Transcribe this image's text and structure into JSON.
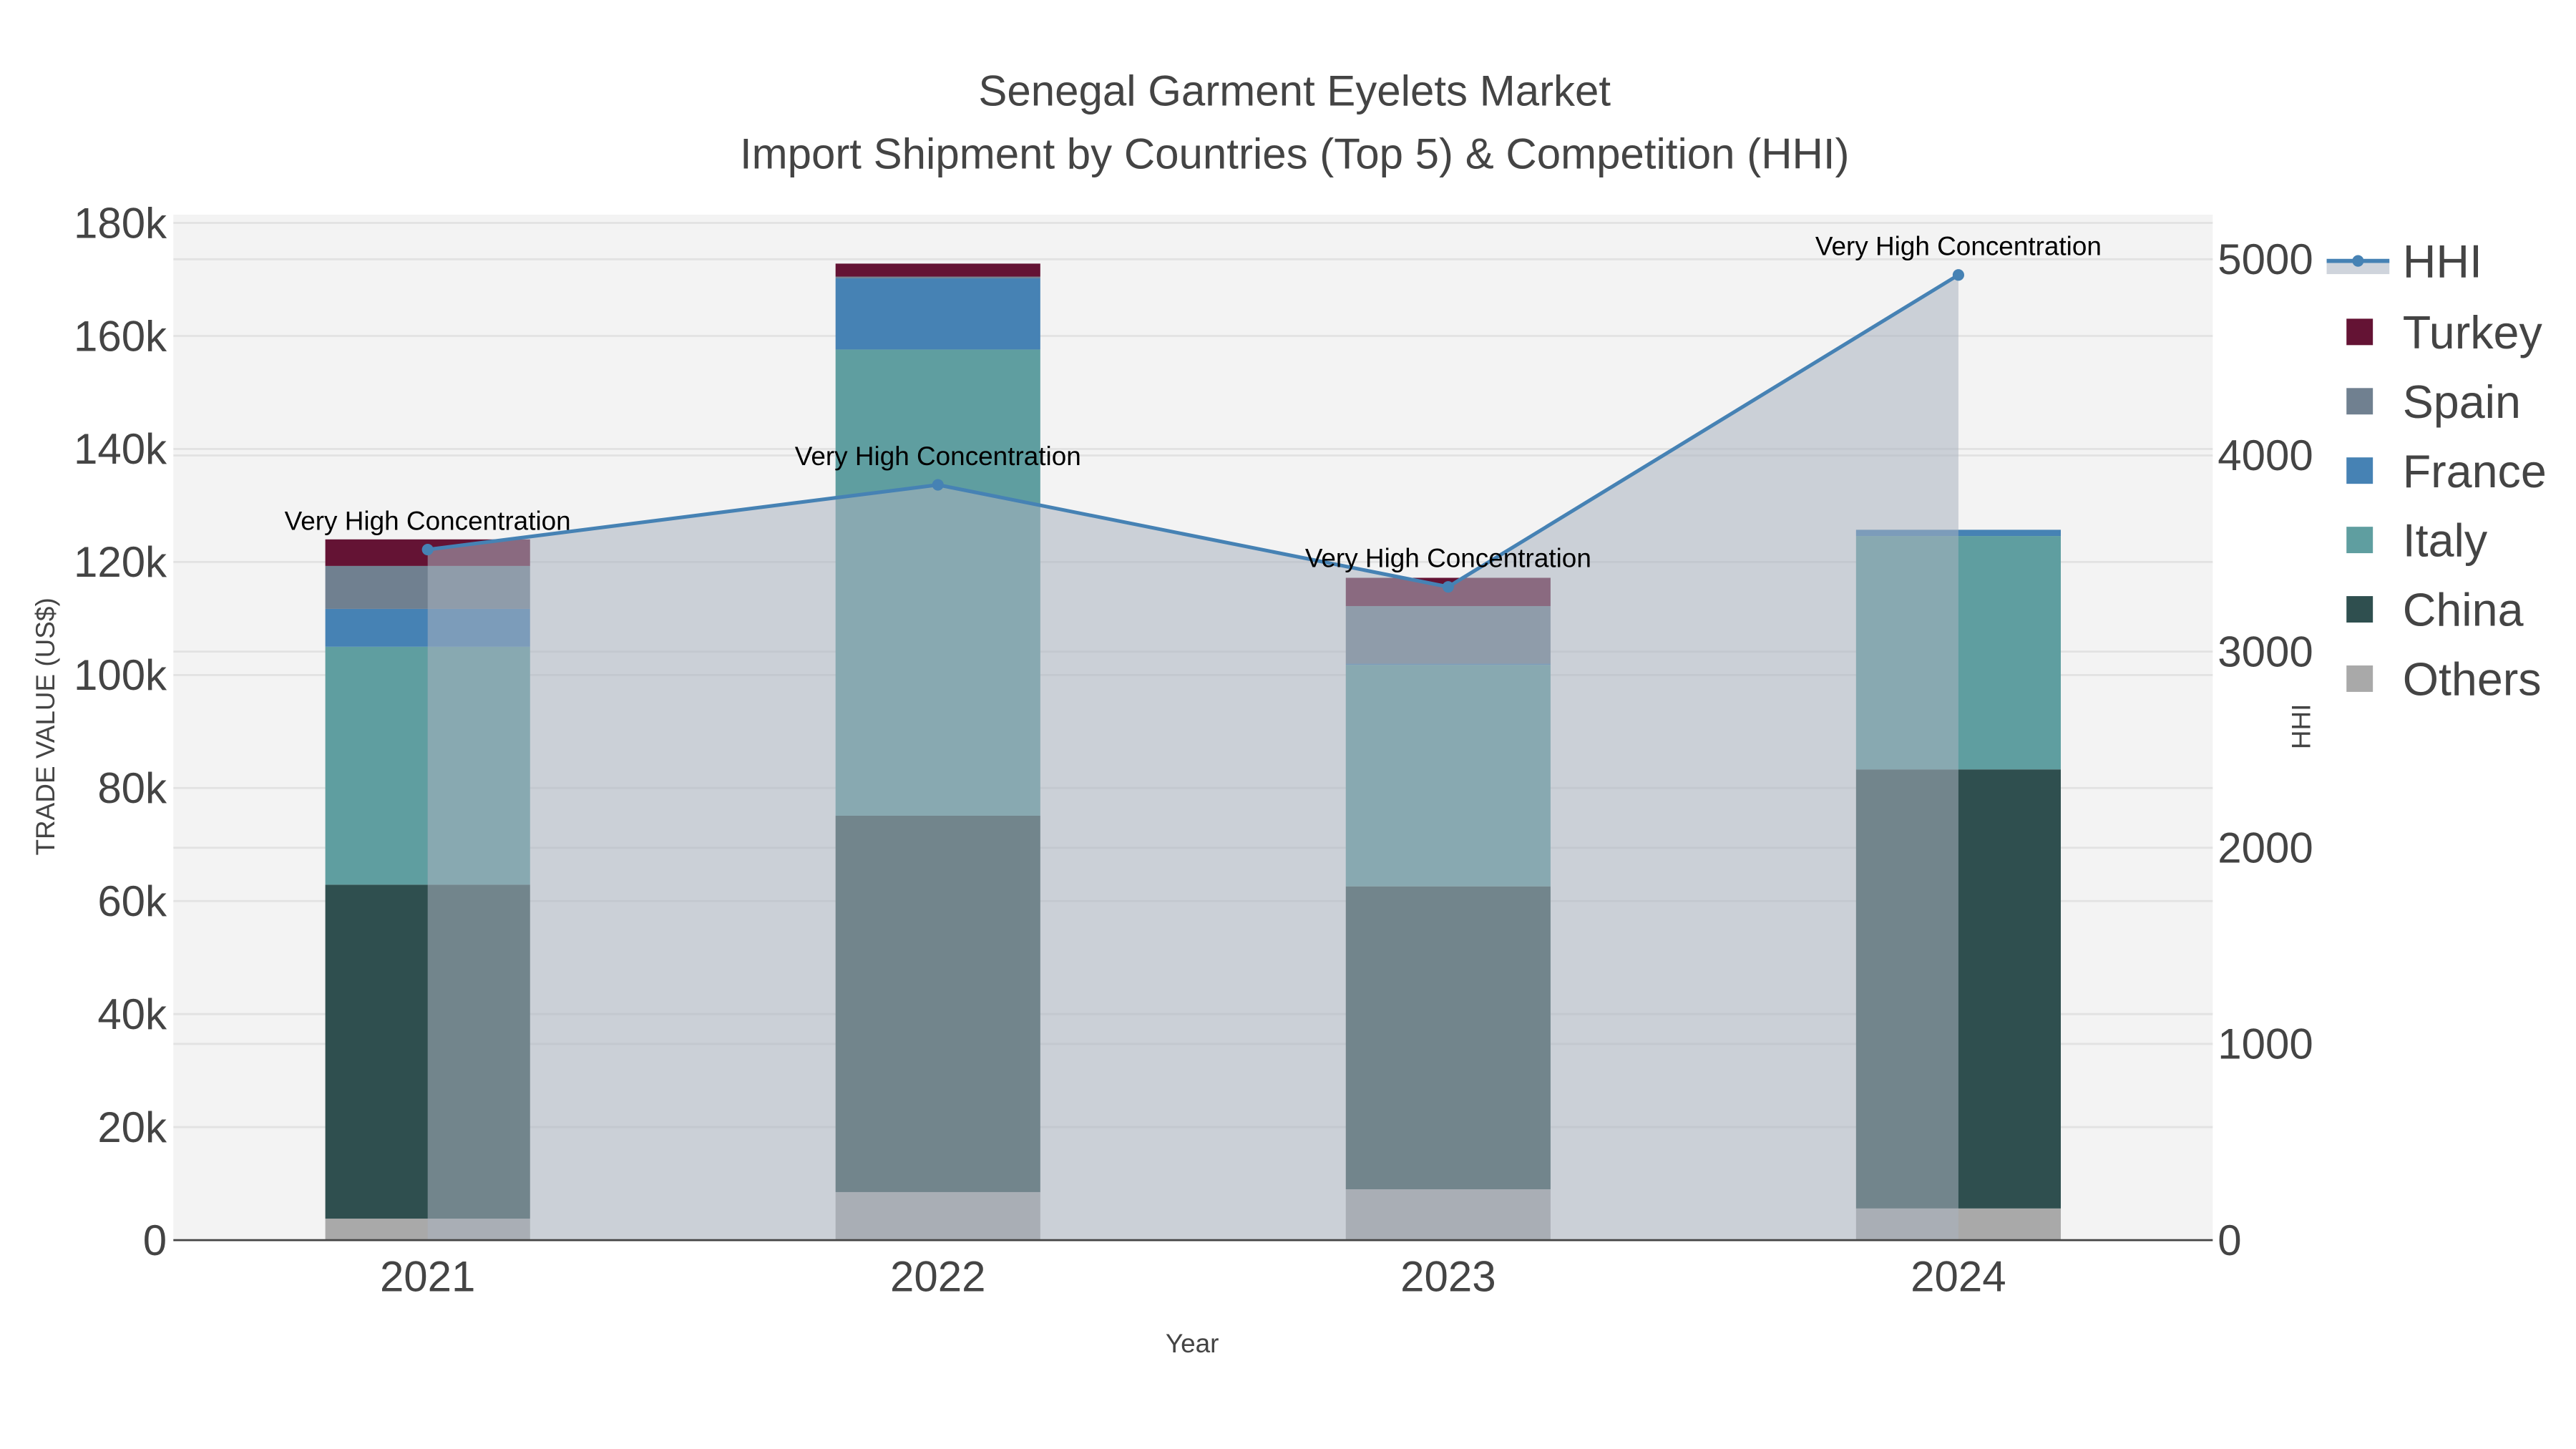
{
  "chart_data": {
    "type": "bar",
    "stacked": true,
    "title": "Senegal Garment Eyelets Market",
    "subtitle": "Import Shipment by Countries (Top 5) & Competition (HHI)",
    "xlabel": "Year",
    "ylabel": "TRADE VALUE (US$)",
    "y2label": "HHI",
    "categories": [
      "2021",
      "2022",
      "2023",
      "2024"
    ],
    "ylim": [
      0,
      180000
    ],
    "y2lim": [
      0,
      5200
    ],
    "yticks": [
      0,
      20000,
      40000,
      60000,
      80000,
      100000,
      120000,
      140000,
      160000,
      180000
    ],
    "ytick_labels": [
      "0",
      "20k",
      "40k",
      "60k",
      "80k",
      "100k",
      "120k",
      "140k",
      "160k",
      "180k"
    ],
    "y2ticks": [
      0,
      1000,
      2000,
      3000,
      4000,
      5000
    ],
    "y2tick_labels": [
      "0",
      "1000",
      "2000",
      "3000",
      "4000",
      "5000"
    ],
    "series": [
      {
        "name": "Others",
        "color": "#a9a9a9",
        "values": [
          3800,
          8500,
          9000,
          5600
        ]
      },
      {
        "name": "China",
        "color": "#2f4f4f",
        "values": [
          59100,
          66600,
          53600,
          77700
        ]
      },
      {
        "name": "Italy",
        "color": "#5f9ea0",
        "values": [
          42100,
          82500,
          39200,
          41300
        ]
      },
      {
        "name": "France",
        "color": "#4682b4",
        "values": [
          6700,
          12600,
          200,
          1100
        ]
      },
      {
        "name": "Spain",
        "color": "#708090",
        "values": [
          7600,
          300,
          10200,
          0
        ]
      },
      {
        "name": "Turkey",
        "color": "#641334",
        "values": [
          4700,
          2300,
          5000,
          0
        ]
      }
    ],
    "line": {
      "name": "HHI",
      "color": "#4682b4",
      "fill": "tozeroy",
      "values": [
        3520,
        3850,
        3330,
        4920
      ],
      "annotations": [
        "Very High Concentration",
        "Very High Concentration",
        "Very High Concentration",
        "Very High Concentration"
      ]
    },
    "legend": {
      "position": "right",
      "order": [
        "HHI",
        "Turkey",
        "Spain",
        "France",
        "Italy",
        "China",
        "Others"
      ]
    },
    "grid": true
  }
}
